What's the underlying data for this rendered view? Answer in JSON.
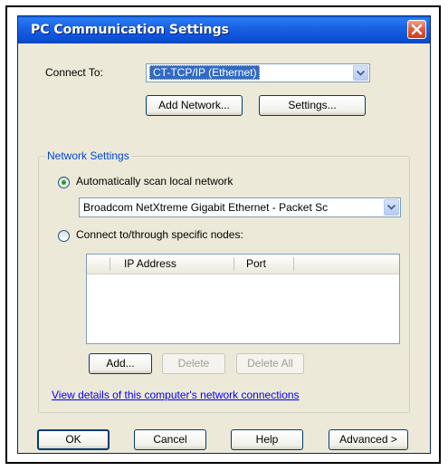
{
  "window": {
    "title": "PC Communication Settings"
  },
  "connect_to": {
    "label": "Connect To:",
    "value": "CT-TCP/IP (Ethernet)"
  },
  "buttons_top": {
    "add_network": "Add Network...",
    "settings": "Settings..."
  },
  "network_settings": {
    "group_title": "Network Settings",
    "auto_scan_label": "Automatically scan local network",
    "auto_scan_selected": true,
    "adapter_value": "Broadcom NetXtreme Gigabit Ethernet - Packet Sc",
    "specific_nodes_label": "Connect to/through specific nodes:",
    "specific_nodes_selected": false,
    "columns": [
      "IP Address",
      "Port"
    ],
    "rows": [],
    "add_label": "Add...",
    "delete_label": "Delete",
    "delete_all_label": "Delete All",
    "link_text": "View details of this computer's network connections"
  },
  "footer": {
    "ok": "OK",
    "cancel": "Cancel",
    "help": "Help",
    "advanced": "Advanced >"
  },
  "colors": {
    "titlebar": "#0b4fd4",
    "dialog_bg": "#ece9d8",
    "selection": "#316ac5",
    "link": "#0000ff",
    "group_title": "#0046d5"
  },
  "icons": [
    "close-icon",
    "dropdown-arrow-icon"
  ]
}
